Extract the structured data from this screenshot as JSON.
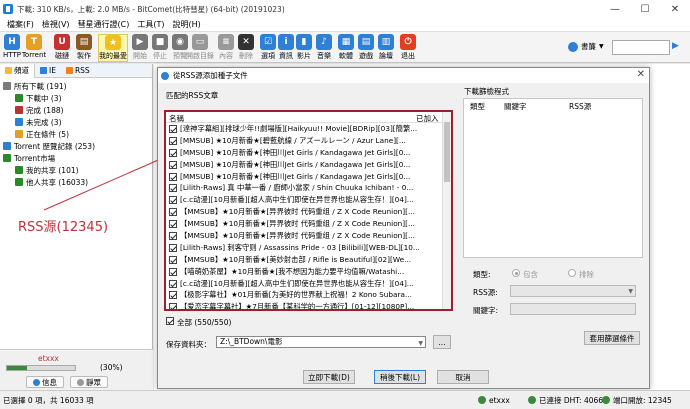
{
  "window": {
    "title": "下載: 310 KB/s，上載: 2.0 MB/s - BitComet(比特彗星) (64-bit) (20191023)",
    "controls": [
      "—",
      "☐",
      "✕"
    ]
  },
  "menu": [
    "檔案(F)",
    "檢視(V)",
    "彗星通行證(C)",
    "工具(T)",
    "說明(H)"
  ],
  "toolbar": {
    "buttons": [
      {
        "label": "HTTP",
        "icon": "http-icon",
        "color": "#2e7fd6",
        "glyph": "H",
        "dim": false
      },
      {
        "label": "Torrent",
        "icon": "torrent-icon",
        "color": "#e6a020",
        "glyph": "T",
        "dim": false
      },
      {
        "label": "磁鏈",
        "icon": "magnet-icon",
        "color": "#c83030",
        "glyph": "U",
        "dim": false
      },
      {
        "label": "製作",
        "icon": "make-icon",
        "color": "#8a5a20",
        "glyph": "▤",
        "dim": false
      },
      {
        "label": "我的最愛",
        "icon": "star-icon",
        "color": "#f0c020",
        "glyph": "★",
        "dim": false
      },
      {
        "label": "開始",
        "icon": "start-icon",
        "color": "#777777",
        "glyph": "▶",
        "dim": true
      },
      {
        "label": "停止",
        "icon": "stop-icon",
        "color": "#777777",
        "glyph": "■",
        "dim": true
      },
      {
        "label": "預覽",
        "icon": "preview-icon",
        "color": "#777777",
        "glyph": "◉",
        "dim": true
      },
      {
        "label": "開啟目錄",
        "icon": "open-folder-icon",
        "color": "#999999",
        "glyph": "▭",
        "dim": true
      },
      {
        "label": "內容",
        "icon": "properties-icon",
        "color": "#999999",
        "glyph": "≡",
        "dim": true
      },
      {
        "label": "刪除",
        "icon": "delete-icon",
        "color": "#333333",
        "glyph": "✕",
        "dim": true
      },
      {
        "label": "選項",
        "icon": "options-icon",
        "color": "#2e7fd6",
        "glyph": "☑",
        "dim": false
      },
      {
        "label": "資訊",
        "icon": "info-icon",
        "color": "#2e7fd6",
        "glyph": "i",
        "dim": false
      },
      {
        "label": "影片",
        "icon": "video-icon",
        "color": "#2e7fd6",
        "glyph": "▮",
        "dim": false
      },
      {
        "label": "音樂",
        "icon": "music-icon",
        "color": "#2e7fd6",
        "glyph": "♪",
        "dim": false
      },
      {
        "label": "軟體",
        "icon": "software-icon",
        "color": "#2e7fd6",
        "glyph": "▦",
        "dim": false
      },
      {
        "label": "遊戲",
        "icon": "game-icon",
        "color": "#2e7fd6",
        "glyph": "▤",
        "dim": false
      },
      {
        "label": "論壇",
        "icon": "forum-icon",
        "color": "#2e7fd6",
        "glyph": "▥",
        "dim": false
      },
      {
        "label": "退出",
        "icon": "exit-icon",
        "color": "#e04020",
        "glyph": "⏻",
        "dim": false
      }
    ],
    "skin_label": "書簾",
    "search_go": "▶"
  },
  "left_panel": {
    "tabs": [
      "頻道",
      "IE",
      "RSS"
    ],
    "tree": [
      {
        "label": "所有下載 (191)",
        "indent": 0,
        "color": "#7a7a7a"
      },
      {
        "label": "下載中 (3)",
        "indent": 1,
        "color": "#2a8a2a"
      },
      {
        "label": "完成 (188)",
        "indent": 1,
        "color": "#c03030"
      },
      {
        "label": "未完成 (3)",
        "indent": 1,
        "color": "#2e7fd6"
      },
      {
        "label": "正在條件 (5)",
        "indent": 1,
        "color": "#e0a020"
      },
      {
        "label": "Torrent 歷覽記錄 (253)",
        "indent": 0,
        "color": "#2e7fd6"
      },
      {
        "label": "Torrent市場",
        "indent": 0,
        "color": "#2a8a2a"
      },
      {
        "label": "我的共享",
        "indent": 1,
        "color": "#2a8a2a"
      },
      {
        "label": "他人共享 (16033)",
        "indent": 1,
        "color": "#2a8a2a"
      },
      {
        "label": "我的共享 (101)",
        "indent": 1,
        "color": "#2a8a2a"
      }
    ],
    "annotation": "RSS源(12345)",
    "user": {
      "name": "etxxx",
      "progress": 0.3,
      "percent": "(30%)",
      "tabs": [
        "信息",
        "靜眾"
      ]
    }
  },
  "dialog": {
    "title": "從RSS源添加種子文件",
    "close": "✕",
    "group_left": "匹配的RSS文章",
    "group_right": "下載篩檢程式",
    "columns": {
      "name": "名稱",
      "added": "已加入"
    },
    "rows": [
      "[達神字幕組][排球少年!!劇場版][Haikyuu!! Movie][BDRip][03][簡繁...",
      "[MMSUB] ★10月新番★[碧藍航線 / アズールレーン / Azur Lane][...",
      "[MMSUB] ★10月新番★[神田川Jet Girls / Kandagawa Jet Girls][0...",
      "[MMSUB] ★10月新番★[神田川Jet Girls / Kandagawa Jet Girls][0...",
      "[MMSUB] ★10月新番★[神田川Jet Girls / Kandagawa Jet Girls][0...",
      "[Lilith-Raws] 真 中華一番 / 廚師小當家 / Shin Chuuka Ichiban! - 0...",
      "[c.c动漫][10月新番][超人高中生们即使在异世界也能从容生存！][04]...",
      "【MMSUB】★10月新番★[异界彼时 代码重组 / Z X Code Reunion][...",
      "【MMSUB】★10月新番★[异界彼时 代码重组 / Z X Code Reunion][...",
      "【MMSUB】★10月新番★[异界彼时 代码重组 / Z X Code Reunion][...",
      "[Lilith-Raws] 刺客守则 / Assassins Pride - 03 [Bilibili][WEB-DL][10...",
      "【MMSUB】★10月新番★[美妙射击部 / Rifle is Beautiful][02][We...",
      "【喵萌奶茶屋】★10月新番★[我不想因为能力要平均值嘛/Watashi...",
      "[c.c动漫][10月新番][超人高中生们即使在异世界也能从容生存！][04]...",
      "【极影字幕社】★01月新番[为美好的世界献上祝福！2 Kono Subara...",
      "【爱恋字幕字幕社】★7月新番【某科学的一方通行】[01-12][1080P]..."
    ],
    "checked_count": 16,
    "right_columns": [
      "類型",
      "關鍵字",
      "RSS源"
    ],
    "type_label": "類型:",
    "include_label": "包含",
    "exclude_label": "排除",
    "rss_source_label": "RSS源:",
    "keyword_label": "關鍵字:",
    "apply_filter_button": "套用篩選條件",
    "select_all": "全部 (550/550)",
    "save_to_label": "保存資料夾：",
    "save_to_path": "Z:\\_BTDown\\電影",
    "browse_button": "...",
    "buttons": [
      "立即下載(D)",
      "稍後下載(L)",
      "取消"
    ]
  },
  "status_bar": {
    "left": "已選擇 0 項，共 16033 項",
    "user": "etxxx",
    "dht": "已連接 DHT: 4066",
    "ports": "端口開放: 12345"
  }
}
